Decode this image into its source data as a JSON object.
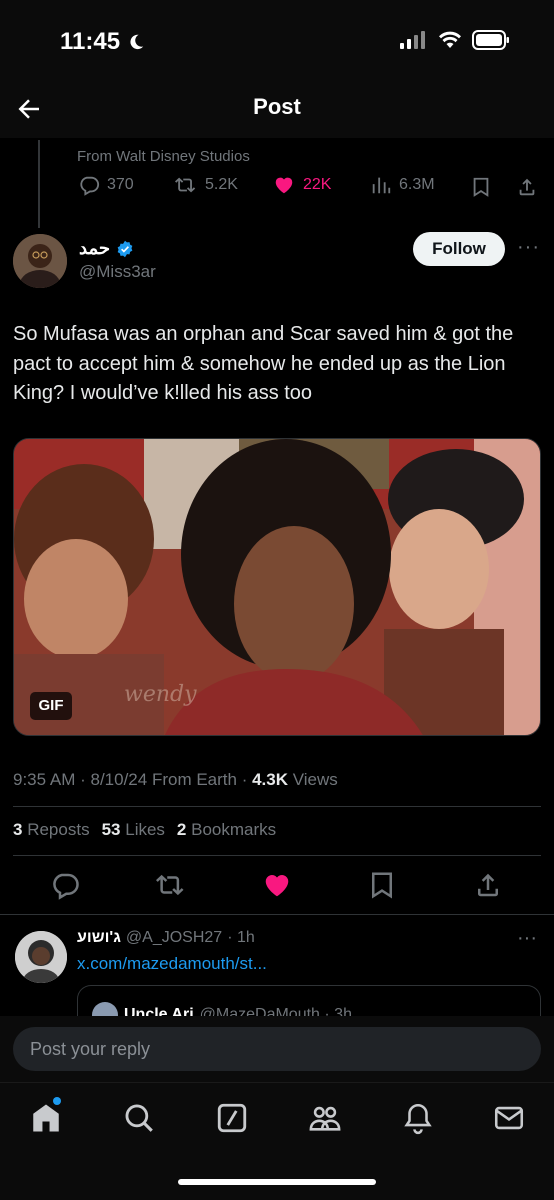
{
  "status": {
    "time": "11:45"
  },
  "header": {
    "title": "Post"
  },
  "previous_post": {
    "source": "From Walt Disney Studios",
    "replies": "370",
    "reposts": "5.2K",
    "likes": "22K",
    "views": "6.3M"
  },
  "post": {
    "author_name": "حمد",
    "author_handle": "@Miss3ar",
    "follow_label": "Follow",
    "text": "So Mufasa was an orphan and Scar saved him & got the pact to accept him & somehow he ended up as the Lion King? I would’ve k!lled his ass too",
    "media_badge": "GIF",
    "time": "9:35 AM",
    "date": "8/10/24",
    "location": "From Earth",
    "views_count": "4.3K",
    "views_label": "Views",
    "reposts_count": "3",
    "reposts_label": "Reposts",
    "likes_count": "53",
    "likes_label": "Likes",
    "bookmarks_count": "2",
    "bookmarks_label": "Bookmarks"
  },
  "reply": {
    "author_name": "ג'ושוע",
    "author_handle": "@A_JOSH27",
    "age": "· 1h",
    "link_text": "x.com/mazedamouth/st...",
    "quote_name": "Uncle Ari",
    "quote_handle": "@MazeDaMouth · 3h"
  },
  "reply_bar": {
    "placeholder": "Post your reply"
  },
  "colors": {
    "accent": "#1d9bf0",
    "like": "#f91880",
    "background": "#000000"
  },
  "icons": [
    "back-arrow-icon",
    "reply-icon",
    "repost-icon",
    "heart-icon",
    "views-icon",
    "bookmark-icon",
    "share-icon",
    "verified-icon",
    "home-icon",
    "search-icon",
    "grok-icon",
    "communities-icon",
    "notifications-icon",
    "messages-icon"
  ]
}
